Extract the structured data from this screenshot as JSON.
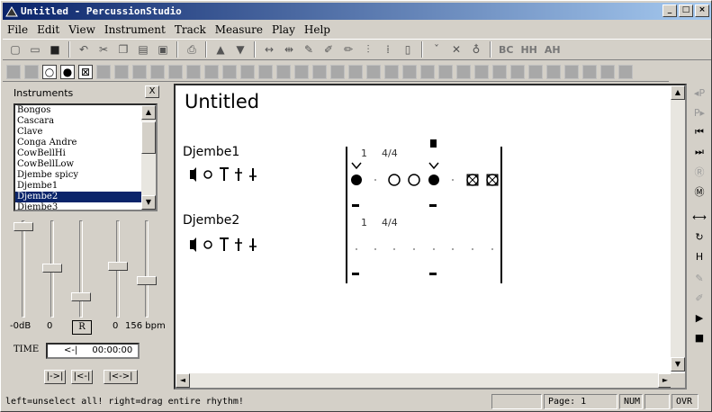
{
  "window": {
    "title": "Untitled - PercussionStudio"
  },
  "menu": [
    "File",
    "Edit",
    "View",
    "Instrument",
    "Track",
    "Measure",
    "Play",
    "Help"
  ],
  "toolbar": {
    "text_buttons": [
      "BC",
      "HH",
      "AH"
    ]
  },
  "instruments_panel": {
    "label": "Instruments",
    "close_label": "X",
    "items": [
      "Bongos",
      "Cascara",
      "Clave",
      "Conga Andre",
      "CowBellHi",
      "CowBellLow",
      "Djembe spicy",
      "Djembe1",
      "Djembe2",
      "Djembe3"
    ],
    "selected": "Djembe2"
  },
  "mixer": {
    "volume_label": "-0dB",
    "value2": "0",
    "reset_label": "R",
    "value3": "0",
    "tempo_label": "156 bpm",
    "time_label": "TIME",
    "time_arrow": "<-|",
    "time_value": "00:00:00",
    "transport": [
      "|->|",
      "|<-|",
      "|<->|"
    ]
  },
  "document": {
    "title": "Untitled",
    "tracks": [
      {
        "name": "Djembe1",
        "measure": "1",
        "time_signature": "4/4"
      },
      {
        "name": "Djembe2",
        "measure": "1",
        "time_signature": "4/4"
      }
    ]
  },
  "statusbar": {
    "message": "left=unselect all! right=drag entire rhythm!",
    "page": "Page: 1",
    "num": "NUM",
    "ovr": "OVR"
  }
}
